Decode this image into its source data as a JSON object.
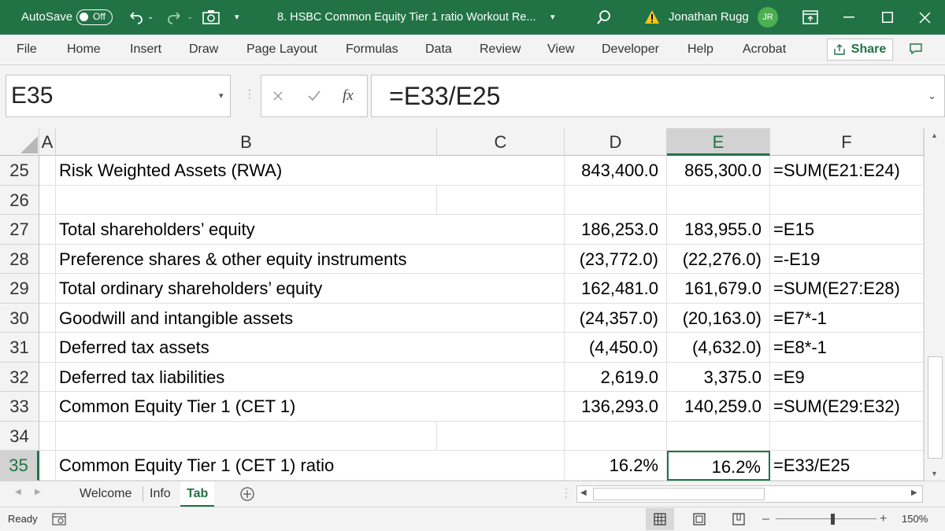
{
  "titlebar": {
    "autosave_label": "AutoSave",
    "autosave_state": "Off",
    "document_title": "8. HSBC Common Equity Tier 1 ratio Workout Re...",
    "user_name": "Jonathan Rugg",
    "user_initials": "JR",
    "share_label": "Share"
  },
  "menu": [
    "File",
    "Home",
    "Insert",
    "Draw",
    "Page Layout",
    "Formulas",
    "Data",
    "Review",
    "View",
    "Developer",
    "Help",
    "Acrobat"
  ],
  "formula_bar": {
    "name_box": "E35",
    "fx_label": "fx",
    "formula": "=E33/E25"
  },
  "columns": [
    "A",
    "B",
    "C",
    "D",
    "E",
    "F"
  ],
  "selected_column": "E",
  "rows": [
    {
      "num": "25",
      "b": "Risk Weighted Assets (RWA)",
      "d": "843,400.0",
      "e": "865,300.0",
      "f": "=SUM(E21:E24)"
    },
    {
      "num": "26",
      "b": "",
      "d": "",
      "e": "",
      "f": ""
    },
    {
      "num": "27",
      "b": "Total shareholders’ equity",
      "d": "186,253.0",
      "e": "183,955.0",
      "f": "=E15"
    },
    {
      "num": "28",
      "b": "Preference shares & other equity instruments",
      "d": "(23,772.0)",
      "e": "(22,276.0)",
      "f": "=-E19"
    },
    {
      "num": "29",
      "b": "Total ordinary shareholders’ equity",
      "d": "162,481.0",
      "e": "161,679.0",
      "f": "=SUM(E27:E28)"
    },
    {
      "num": "30",
      "b": "Goodwill and intangible assets",
      "d": "(24,357.0)",
      "e": "(20,163.0)",
      "f": "=E7*-1"
    },
    {
      "num": "31",
      "b": "Deferred tax assets",
      "d": "(4,450.0)",
      "e": "(4,632.0)",
      "f": "=E8*-1"
    },
    {
      "num": "32",
      "b": "Deferred tax liabilities",
      "d": "2,619.0",
      "e": "3,375.0",
      "f": "=E9"
    },
    {
      "num": "33",
      "b": "Common Equity Tier 1 (CET 1)",
      "d": "136,293.0",
      "e": "140,259.0",
      "f": "=SUM(E29:E32)"
    },
    {
      "num": "34",
      "b": "",
      "d": "",
      "e": "",
      "f": ""
    },
    {
      "num": "35",
      "b": "Common Equity Tier 1 (CET 1) ratio",
      "d": "16.2%",
      "e": "16.2%",
      "f": "=E33/E25"
    }
  ],
  "selected_row": "35",
  "sheet_tabs": [
    "Welcome",
    "Info",
    "Tab"
  ],
  "active_tab": "Tab",
  "status": {
    "ready": "Ready",
    "zoom": "150%"
  }
}
